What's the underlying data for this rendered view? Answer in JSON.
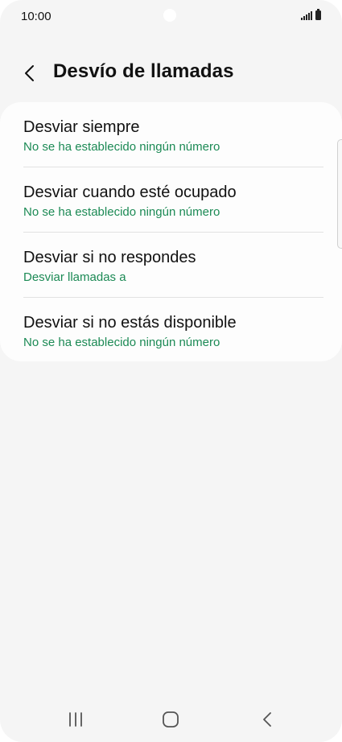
{
  "status_bar": {
    "time": "10:00"
  },
  "header": {
    "title": "Desvío de llamadas",
    "back_icon": "chevron-left-icon"
  },
  "items": [
    {
      "title": "Desviar siempre",
      "subtitle": "No se ha establecido ningún número"
    },
    {
      "title": "Desviar cuando esté ocupado",
      "subtitle": "No se ha establecido ningún número"
    },
    {
      "title": "Desviar si no respondes",
      "subtitle": "Desviar llamadas a"
    },
    {
      "title": "Desviar si no estás disponible",
      "subtitle": "No se ha establecido ningún número"
    }
  ],
  "nav_bar": {
    "recents_icon": "recents-icon",
    "home_icon": "home-icon",
    "back_icon": "back-icon"
  },
  "colors": {
    "background": "#f5f5f5",
    "card": "#fdfdfd",
    "accent_green": "#1c8a55",
    "text_primary": "#111111"
  }
}
